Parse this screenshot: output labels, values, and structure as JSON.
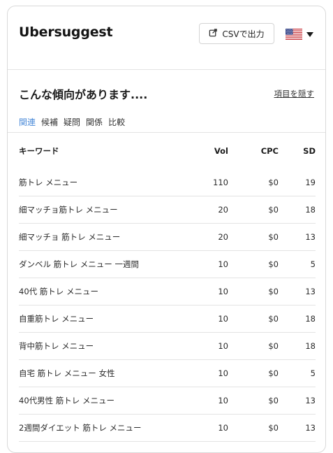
{
  "app": {
    "logo": "Ubersuggest",
    "csv_button": "CSVで出力",
    "country_flag": "us-flag-icon"
  },
  "section": {
    "title": "こんな傾向があります....",
    "hide_link": "項目を隠す",
    "tabs": [
      {
        "label": "関連",
        "active": true
      },
      {
        "label": "候補",
        "active": false
      },
      {
        "label": "疑問",
        "active": false
      },
      {
        "label": "関係",
        "active": false
      },
      {
        "label": "比較",
        "active": false
      }
    ]
  },
  "table": {
    "headers": {
      "keyword": "キーワード",
      "vol": "Vol",
      "cpc": "CPC",
      "sd": "SD"
    },
    "rows": [
      {
        "keyword": "筋トレ メニュー",
        "vol": "110",
        "cpc": "$0",
        "sd": "19"
      },
      {
        "keyword": "細マッチョ筋トレ メニュー",
        "vol": "20",
        "cpc": "$0",
        "sd": "18"
      },
      {
        "keyword": "細マッチョ 筋トレ メニュー",
        "vol": "20",
        "cpc": "$0",
        "sd": "13"
      },
      {
        "keyword": "ダンベル 筋トレ メニュー 一週間",
        "vol": "10",
        "cpc": "$0",
        "sd": "5"
      },
      {
        "keyword": "40代 筋トレ メニュー",
        "vol": "10",
        "cpc": "$0",
        "sd": "13"
      },
      {
        "keyword": "自重筋トレ メニュー",
        "vol": "10",
        "cpc": "$0",
        "sd": "18"
      },
      {
        "keyword": "背中筋トレ メニュー",
        "vol": "10",
        "cpc": "$0",
        "sd": "18"
      },
      {
        "keyword": "自宅 筋トレ メニュー 女性",
        "vol": "10",
        "cpc": "$0",
        "sd": "5"
      },
      {
        "keyword": "40代男性 筋トレ メニュー",
        "vol": "10",
        "cpc": "$0",
        "sd": "13"
      },
      {
        "keyword": "2週間ダイエット 筋トレ メニュー",
        "vol": "10",
        "cpc": "$0",
        "sd": "13"
      }
    ]
  },
  "colors": {
    "active_tab": "#4a8ad8",
    "border": "#e3e3e3"
  }
}
